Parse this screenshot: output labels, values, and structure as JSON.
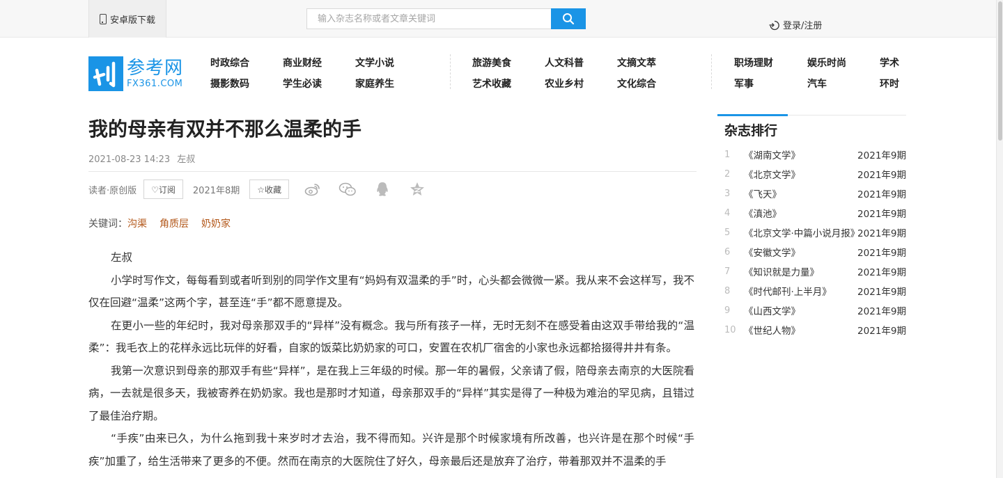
{
  "topbar": {
    "android_label": "安卓版下载",
    "search_placeholder": "输入杂志名称或者文章关键词",
    "login_label": "登录/注册"
  },
  "logo": {
    "cn": "参考网",
    "en": "FX361.COM",
    "mark": "刊"
  },
  "nav": {
    "col1": [
      "时政综合",
      "摄影数码"
    ],
    "col2": [
      "商业财经",
      "学生必读"
    ],
    "col3": [
      "文学小说",
      "家庭养生"
    ],
    "col4": [
      "旅游美食",
      "艺术收藏"
    ],
    "col5": [
      "人文科普",
      "农业乡村"
    ],
    "col6": [
      "文摘文萃",
      "文化综合"
    ],
    "col7": [
      "职场理财",
      "军事"
    ],
    "col8": [
      "娱乐时尚",
      "汽车"
    ],
    "col9": [
      "学术",
      "环时"
    ]
  },
  "article": {
    "title": "我的母亲有双并不那么温柔的手",
    "datetime": "2021-08-23 14:23",
    "author": "左叔",
    "source": "读者·原创版",
    "subscribe_label": "♡订阅",
    "issue": "2021年8期",
    "favorite_label": "☆收藏",
    "keywords_label": "关键词：",
    "keywords": [
      "沟渠",
      "角质层",
      "奶奶家"
    ],
    "paragraphs": [
      "左叔",
      "小学时写作文，每每看到或者听到别的同学作文里有“妈妈有双温柔的手”时，心头都会微微一紧。我从来不会这样写，我不仅在回避“温柔”这两个字，甚至连“手”都不愿意提及。",
      "在更小一些的年纪时，我对母亲那双手的“异样”没有概念。我与所有孩子一样，无时无刻不在感受着由这双手带给我的“温柔”：我毛衣上的花样永远比玩伴的好看，自家的饭菜比奶奶家的可口，安置在农机厂宿舍的小家也永远都拾掇得井井有条。",
      "我第一次意识到母亲的那双手有些“异样”，是在我上三年级的时候。那一年的暑假，父亲请了假，陪母亲去南京的大医院看病，一去就是很多天，我被寄养在奶奶家。我也是那时才知道，母亲那双手的“异样”其实是得了一种极为难治的罕见病，且错过了最佳治疗期。",
      "“手疾”由来已久，为什么拖到我十来岁时才去治，我不得而知。兴许是那个时候家境有所改善，也兴许是在那个时候“手疾”加重了，给生活带来了更多的不便。然而在南京的大医院住了好久，母亲最后还是放弃了治疗，带着那双并不温柔的手"
    ]
  },
  "sidebar": {
    "title": "杂志排行",
    "ranking": [
      {
        "num": "1",
        "name": "《湖南文学》",
        "issue": "2021年9期"
      },
      {
        "num": "2",
        "name": "《北京文学》",
        "issue": "2021年9期"
      },
      {
        "num": "3",
        "name": "《飞天》",
        "issue": "2021年9期"
      },
      {
        "num": "4",
        "name": "《滇池》",
        "issue": "2021年9期"
      },
      {
        "num": "5",
        "name": "《北京文学·中篇小说月报》",
        "issue": "2021年9期"
      },
      {
        "num": "6",
        "name": "《安徽文学》",
        "issue": "2021年9期"
      },
      {
        "num": "7",
        "name": "《知识就是力量》",
        "issue": "2021年9期"
      },
      {
        "num": "8",
        "name": "《时代邮刊·上半月》",
        "issue": "2021年9期"
      },
      {
        "num": "9",
        "name": "《山西文学》",
        "issue": "2021年9期"
      },
      {
        "num": "10",
        "name": "《世纪人物》",
        "issue": "2021年9期"
      }
    ]
  },
  "colors": {
    "accent": "#1a94e6",
    "keyword": "#b3581b"
  },
  "icons": [
    "phone-icon",
    "search-icon",
    "logout-icon",
    "weibo-icon",
    "wechat-icon",
    "qq-icon",
    "qzone-icon"
  ]
}
